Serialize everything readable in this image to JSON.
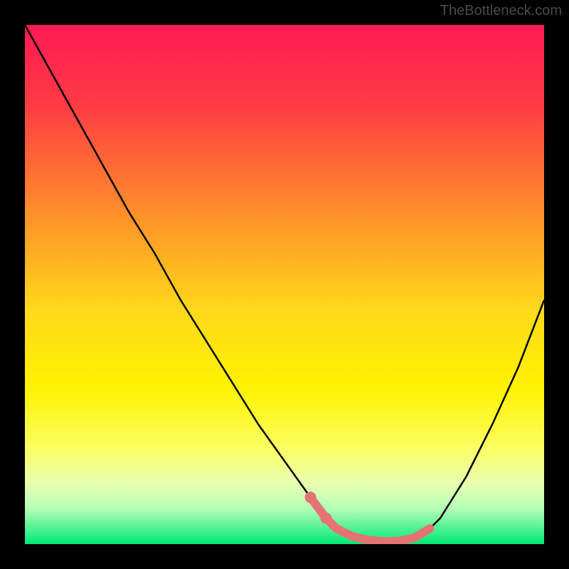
{
  "watermark": "TheBottleneck.com",
  "chart_data": {
    "type": "line",
    "title": "",
    "xlabel": "",
    "ylabel": "",
    "xlim": [
      0,
      100
    ],
    "ylim": [
      0,
      100
    ],
    "background_gradient": {
      "stops": [
        {
          "offset": 0,
          "color": "#ff1a55"
        },
        {
          "offset": 15,
          "color": "#ff3a44"
        },
        {
          "offset": 35,
          "color": "#ff8a2a"
        },
        {
          "offset": 55,
          "color": "#ffd91a"
        },
        {
          "offset": 70,
          "color": "#fff200"
        },
        {
          "offset": 82,
          "color": "#faff66"
        },
        {
          "offset": 88,
          "color": "#e9ffb0"
        },
        {
          "offset": 93,
          "color": "#b8ffb8"
        },
        {
          "offset": 100,
          "color": "#00e878"
        }
      ]
    },
    "curve": {
      "x": [
        0,
        5,
        10,
        15,
        20,
        25,
        30,
        35,
        40,
        45,
        50,
        55,
        58,
        60,
        63,
        66,
        69,
        72,
        75,
        78,
        80,
        85,
        90,
        95,
        100
      ],
      "y": [
        100,
        91,
        82,
        73,
        64,
        56,
        47,
        39,
        31,
        23,
        16,
        9,
        5,
        3,
        1.5,
        0.8,
        0.5,
        0.6,
        1.2,
        3,
        5,
        13,
        23,
        34,
        47
      ]
    },
    "highlight_segment": {
      "color": "#e57373",
      "x": [
        55,
        58,
        60,
        63,
        66,
        69,
        72,
        75,
        78
      ],
      "y": [
        9,
        5,
        3,
        1.5,
        0.8,
        0.5,
        0.6,
        1.2,
        3
      ]
    },
    "highlight_dots": {
      "color": "#e57373",
      "points": [
        {
          "x": 55,
          "y": 9
        },
        {
          "x": 58,
          "y": 5
        }
      ]
    }
  }
}
